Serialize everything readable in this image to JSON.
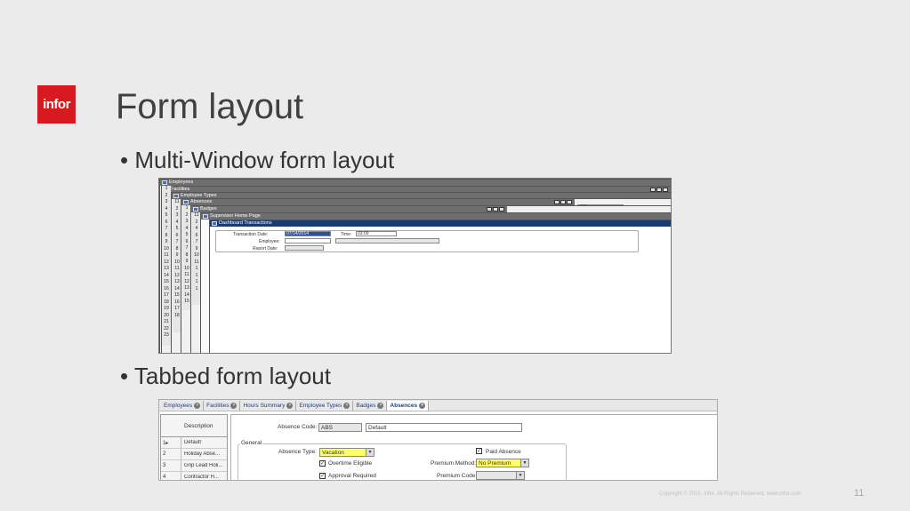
{
  "logo": {
    "text": "infor"
  },
  "slide": {
    "title": "Form layout",
    "bullets": [
      "• Multi-Window form layout",
      "• Tabbed form layout"
    ],
    "copyright": "Copyright © 2015. Infor. All Rights Reserved. www.infor.com",
    "page_number": "11"
  },
  "multiwindow": {
    "windows": [
      {
        "title": "Employees"
      },
      {
        "title": "Facilities"
      },
      {
        "title": "Employee Types"
      },
      {
        "title": "Absences"
      },
      {
        "title": "Badges"
      },
      {
        "title": "Supervisor Home Page"
      },
      {
        "title": "Dashboard Transactions"
      }
    ],
    "row_numbers": [
      "1",
      "2",
      "3",
      "4",
      "5",
      "6",
      "7",
      "8",
      "9",
      "10",
      "11",
      "12",
      "13",
      "14",
      "15",
      "16",
      "17",
      "18",
      "19",
      "20",
      "21",
      "22",
      "23",
      "24"
    ],
    "form": {
      "transaction_date_label": "Transaction Date:",
      "transaction_date_value": "07/14/2014",
      "time_label": "Time:",
      "time_value": "03:09",
      "employee_label": "Employee:",
      "report_date_label": "Report Date:",
      "top_field_value": "001"
    }
  },
  "tabbed": {
    "tabs": [
      "Employees",
      "Facilities",
      "Hours Summary",
      "Employee Types",
      "Badges",
      "Absences"
    ],
    "active_tab": "Absences",
    "grid": {
      "header": "Description",
      "rows": [
        {
          "n": "1▸",
          "d": "Default"
        },
        {
          "n": "2",
          "d": "Holiday Abse..."
        },
        {
          "n": "3",
          "d": "Grip Lead Holi..."
        },
        {
          "n": "4",
          "d": "Contractor H..."
        }
      ]
    },
    "form": {
      "absence_code_label": "Absence Code:",
      "absence_code_value": "ABS",
      "absence_desc_value": "Default",
      "general_group": "General",
      "absence_type_label": "Absence Type:",
      "absence_type_value": "Vacation",
      "overtime_eligible": "Overtime Eligible",
      "approval_required": "Approval Required",
      "paid_absence": "Paid Absence",
      "premium_method_label": "Premium Method:",
      "premium_method_value": "No Premium",
      "premium_code_label": "Premium Code:"
    }
  },
  "colors": {
    "brand": "#d71920",
    "active_title": "#1c3a72",
    "highlight": "#ffff66"
  }
}
